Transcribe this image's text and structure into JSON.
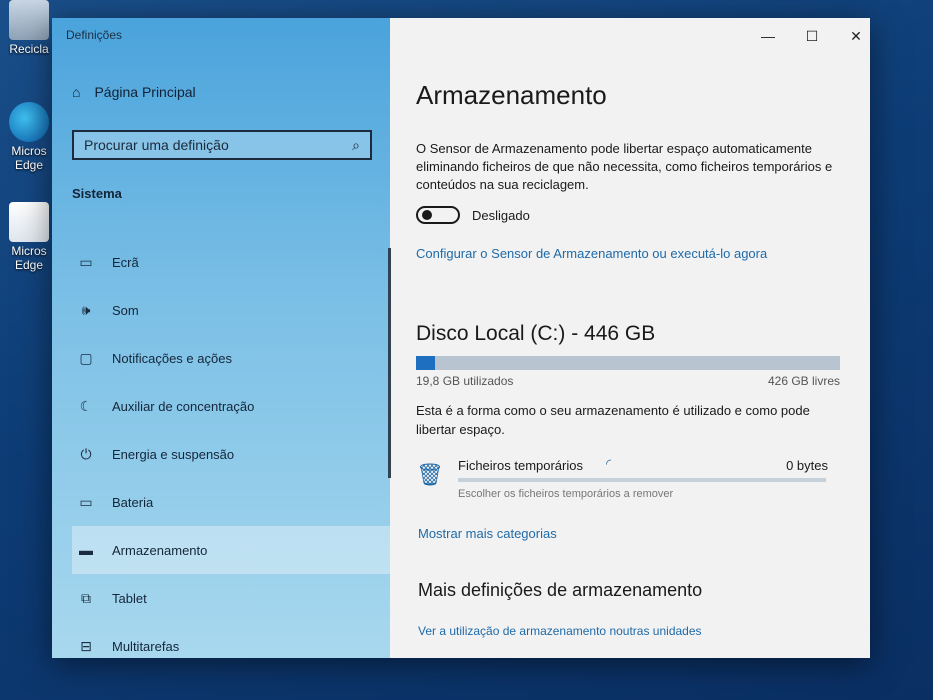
{
  "desktop": {
    "icons": [
      {
        "label": "Recicla"
      },
      {
        "label": "Micros Edge"
      },
      {
        "label": "Micros Edge"
      }
    ]
  },
  "window": {
    "app_title": "Definições",
    "controls": {
      "minimize": "—",
      "maximize": "☐",
      "close": "✕"
    }
  },
  "sidebar": {
    "home": "Página Principal",
    "search_placeholder": "Procurar uma definição",
    "section": "Sistema",
    "items": [
      {
        "label": "Ecrã",
        "icon": "monitor-icon"
      },
      {
        "label": "Som",
        "icon": "speaker-icon"
      },
      {
        "label": "Notificações e ações",
        "icon": "notification-icon"
      },
      {
        "label": "Auxiliar de concentração",
        "icon": "moon-icon"
      },
      {
        "label": "Energia e suspensão",
        "icon": "power-icon"
      },
      {
        "label": "Bateria",
        "icon": "battery-icon"
      },
      {
        "label": "Armazenamento",
        "icon": "storage-icon",
        "active": true
      },
      {
        "label": "Tablet",
        "icon": "tablet-icon"
      },
      {
        "label": "Multitarefas",
        "icon": "multitask-icon"
      }
    ]
  },
  "main": {
    "title": "Armazenamento",
    "sensor_description": "O Sensor de Armazenamento pode libertar espaço automaticamente eliminando ficheiros de que não necessita, como ficheiros temporários e conteúdos na sua reciclagem.",
    "toggle_state": "Desligado",
    "configure_link": "Configurar o Sensor de Armazenamento ou executá-lo agora",
    "disk_title": "Disco Local (C:) - 446 GB",
    "used_label": "19,8 GB utilizados",
    "free_label": "426 GB livres",
    "used_fraction": 0.044,
    "usage_info": "Esta é a forma como o seu armazenamento é utilizado e como pode libertar espaço.",
    "temp_files": {
      "name": "Ficheiros temporários",
      "size": "0 bytes",
      "sub": "Escolher os ficheiros temporários a remover"
    },
    "more_categories": "Mostrar mais categorias",
    "more_settings_title": "Mais definições de armazenamento",
    "usage_other_drives": "Ver a utilização de armazenamento noutras unidades"
  }
}
